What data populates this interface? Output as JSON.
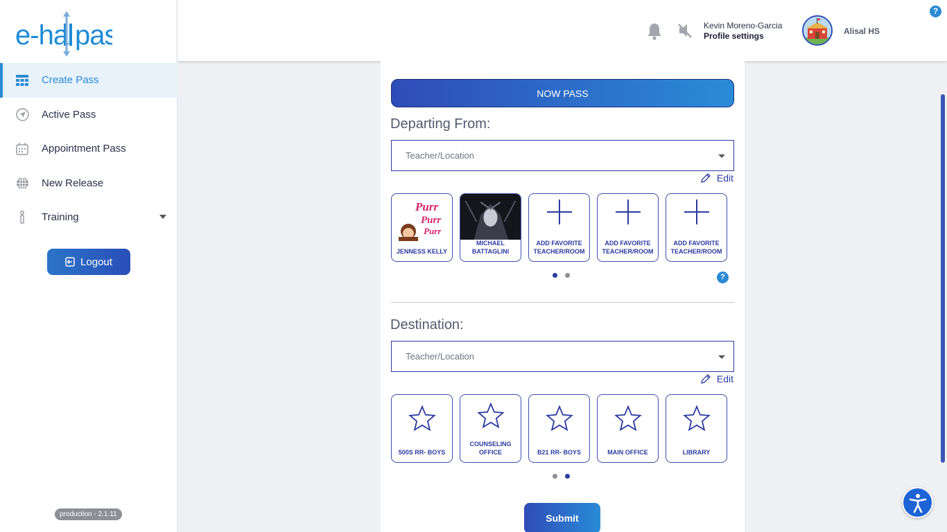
{
  "app": {
    "logo_text": "e-hallpass",
    "version": "production - 2.1.11"
  },
  "sidebar": {
    "items": [
      {
        "label": "Create Pass",
        "icon": "grid-icon"
      },
      {
        "label": "Active Pass",
        "icon": "send-icon"
      },
      {
        "label": "Appointment Pass",
        "icon": "calendar-icon"
      },
      {
        "label": "New Release",
        "icon": "globe-icon"
      },
      {
        "label": "Training",
        "icon": "info-icon"
      }
    ],
    "logout_label": "Logout"
  },
  "header": {
    "user_name": "Kevin Moreno-Garcia",
    "profile_label": "Profile settings",
    "school_name": "Alisal HS",
    "help_symbol": "?"
  },
  "pass_form": {
    "now_pass_label": "NOW PASS",
    "departing": {
      "label": "Departing From:",
      "placeholder": "Teacher/Location",
      "edit_label": "Edit",
      "favorites": [
        {
          "label": "JENNESS KELLY"
        },
        {
          "label": "MICHAEL BATTAGLINI"
        },
        {
          "label": "ADD FAVORITE TEACHER/ROOM"
        },
        {
          "label": "ADD FAVORITE TEACHER/ROOM"
        },
        {
          "label": "ADD FAVORITE TEACHER/ROOM"
        }
      ],
      "page": 1,
      "pages": 2
    },
    "destination": {
      "label": "Destination:",
      "placeholder": "Teacher/Location",
      "edit_label": "Edit",
      "favorites": [
        {
          "label": "500S RR- BOYS"
        },
        {
          "label": "COUNSELING OFFICE"
        },
        {
          "label": "B21 RR- BOYS"
        },
        {
          "label": "MAIN OFFICE"
        },
        {
          "label": "LIBRARY"
        }
      ],
      "page": 2,
      "pages": 2
    },
    "help_symbol": "?",
    "submit_label": "Submit"
  },
  "colors": {
    "brand_blue": "#2a8ad3",
    "accent_navy": "#2a3aa0"
  }
}
